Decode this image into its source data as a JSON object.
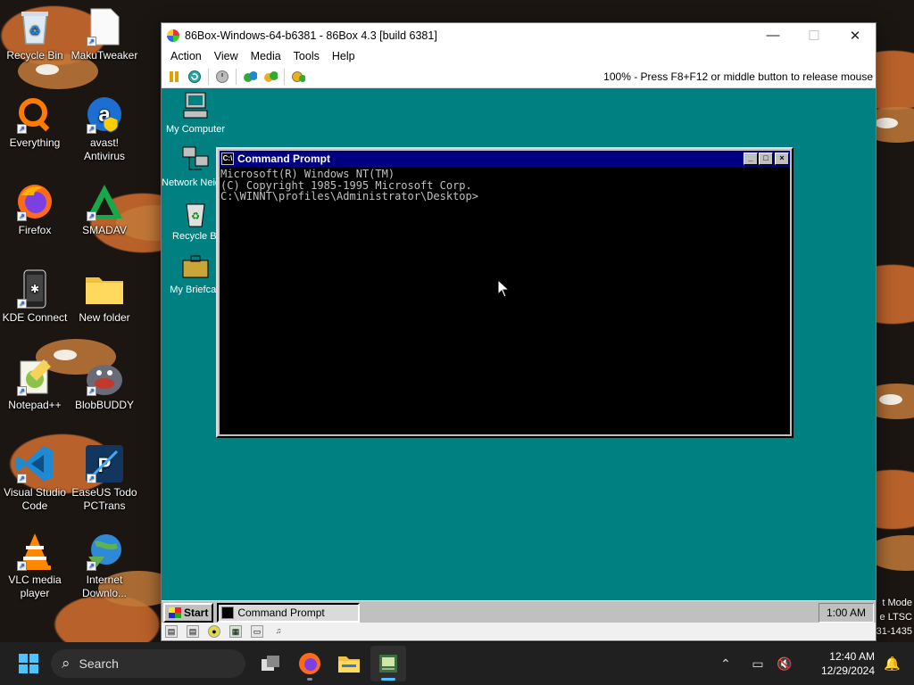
{
  "desktop": {
    "icons": [
      {
        "label": "Recycle Bin",
        "icon": "recycle-bin-icon"
      },
      {
        "label": "MakuTweaker",
        "icon": "file-icon"
      },
      {
        "label": "Everything",
        "icon": "everything-search-icon"
      },
      {
        "label": "avast! Antivirus",
        "icon": "avast-icon"
      },
      {
        "label": "Firefox",
        "icon": "firefox-icon"
      },
      {
        "label": "SMADAV",
        "icon": "smadav-icon"
      },
      {
        "label": "KDE Connect",
        "icon": "kde-connect-icon"
      },
      {
        "label": "New folder",
        "icon": "folder-icon"
      },
      {
        "label": "Notepad++",
        "icon": "notepad-plus-plus-icon"
      },
      {
        "label": "BlobBUDDY",
        "icon": "blobbuddy-icon"
      },
      {
        "label": "Visual Studio Code",
        "icon": "vscode-icon"
      },
      {
        "label": "EaseUS Todo PCTrans",
        "icon": "easeus-icon"
      },
      {
        "label": "VLC media player",
        "icon": "vlc-icon"
      },
      {
        "label": "Internet Downlo...",
        "icon": "internet-download-manager-icon"
      }
    ],
    "edge_text": [
      "t Mode",
      "e LTSC",
      "31-1435"
    ]
  },
  "vm": {
    "title": "86Box-Windows-64-b6381 - 86Box 4.3 [build 6381]",
    "menu": [
      "Action",
      "View",
      "Media",
      "Tools",
      "Help"
    ],
    "status": "100% - Press F8+F12 or middle button to release mouse",
    "guest": {
      "icons": [
        {
          "label": "My Computer"
        },
        {
          "label": "Network Neighborho"
        },
        {
          "label": "Recycle Bi"
        },
        {
          "label": "My Briefcas"
        }
      ],
      "cmd": {
        "title": "Command Prompt",
        "lines": [
          "Microsoft(R) Windows NT(TM)",
          "(C) Copyright 1985-1995 Microsoft Corp.",
          "",
          "C:\\WINNT\\profiles\\Administrator\\Desktop>"
        ]
      },
      "taskbar": {
        "start": "Start",
        "task": "Command Prompt",
        "clock": "1:00 AM"
      }
    }
  },
  "taskbar": {
    "search_placeholder": "Search",
    "time": "12:40 AM",
    "date": "12/29/2024"
  },
  "colors": {
    "guest_desktop": "#008080",
    "title_active": "#000080",
    "win11_accent": "#4cc2ff"
  }
}
